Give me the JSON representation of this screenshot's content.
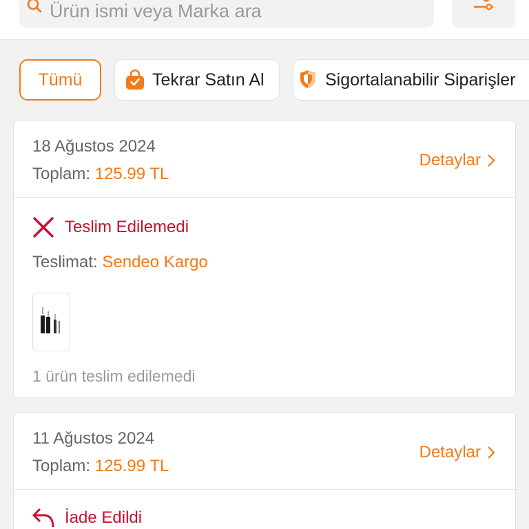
{
  "search": {
    "placeholder": "Ürün ismi veya Marka ara",
    "icon": "search-icon",
    "filter_icon": "sliders-icon"
  },
  "chips": [
    {
      "label": "Tümü",
      "active": true
    },
    {
      "label": "Tekrar Satın Al",
      "icon": "shopping-bag-icon"
    },
    {
      "label": "Sigortalanabilir Siparişler",
      "icon": "shield-icon"
    }
  ],
  "orders": [
    {
      "date": "18 Ağustos 2024",
      "total_label": "Toplam:",
      "total_value": "125.99 TL",
      "details_label": "Detaylar",
      "status": "Teslim Edilemedi",
      "status_icon": "x-icon",
      "delivery_label": "Teslimat:",
      "delivery_company": "Sendeo Kargo",
      "note": "1 ürün teslim edilemedi"
    },
    {
      "date": "11 Ağustos 2024",
      "total_label": "Toplam:",
      "total_value": "125.99 TL",
      "details_label": "Detaylar",
      "status": "İade Edildi",
      "status_icon": "return-arrow-icon"
    }
  ],
  "colors": {
    "accent": "#f27a1a",
    "status_red": "#c8102e",
    "background": "#f2f2f2"
  }
}
